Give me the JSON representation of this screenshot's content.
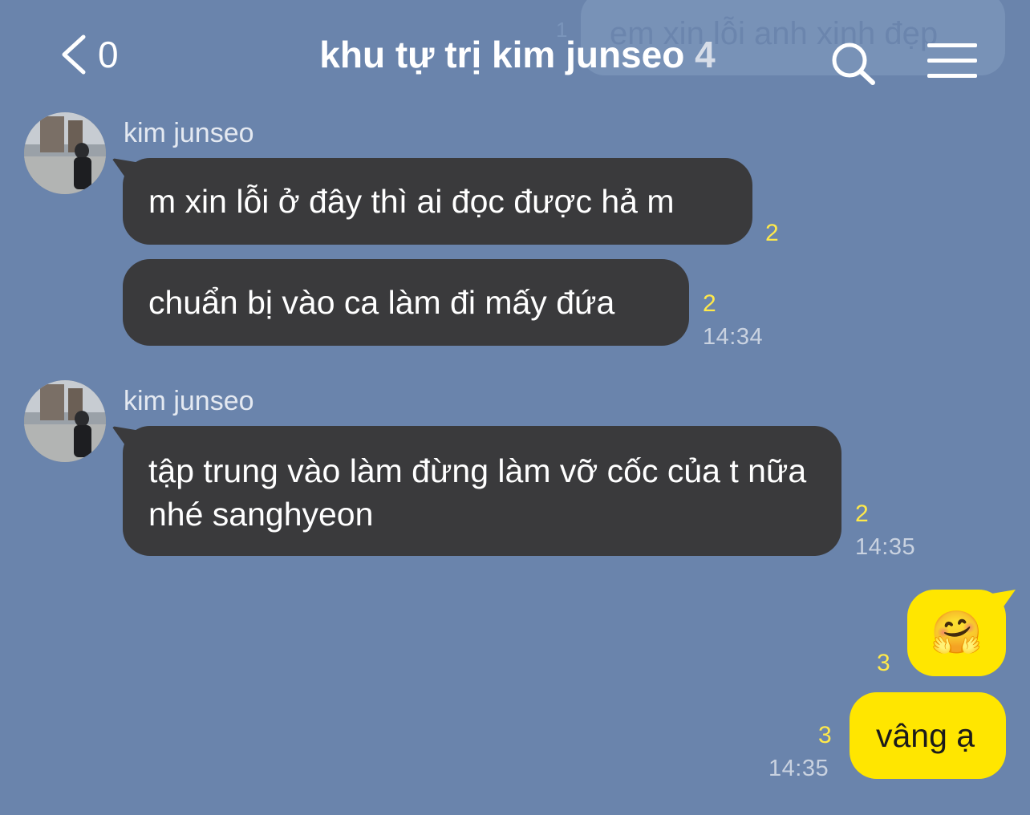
{
  "ghost_message": {
    "text": "em xin lỗi anh xinh đẹp",
    "read_count": "1"
  },
  "header": {
    "back_count": "0",
    "title": "khu tự trị kim junseo",
    "member_count": "4"
  },
  "messages": [
    {
      "sender": "kim junseo",
      "text": "m xin lỗi ở đây thì ai đọc được hả m",
      "read_count": "2"
    },
    {
      "text": "chuẩn bị vào ca làm đi mấy đứa",
      "read_count": "2",
      "time": "14:34"
    },
    {
      "sender": "kim junseo",
      "text": "tập trung vào làm đừng làm vỡ cốc của t nữa nhé sanghyeon",
      "read_count": "2",
      "time": "14:35"
    },
    {
      "mine": true,
      "emoji": "🤗",
      "read_count": "3"
    },
    {
      "mine": true,
      "text": "vâng ạ",
      "read_count": "3",
      "time": "14:35"
    }
  ],
  "colors": {
    "background": "#6a84ac",
    "incoming_bubble": "#3a3a3c",
    "outgoing_bubble": "#ffe600",
    "read_count": "#ffe94a"
  },
  "icons": {
    "back": "chevron-left-icon",
    "search": "search-icon",
    "menu": "hamburger-menu-icon"
  }
}
